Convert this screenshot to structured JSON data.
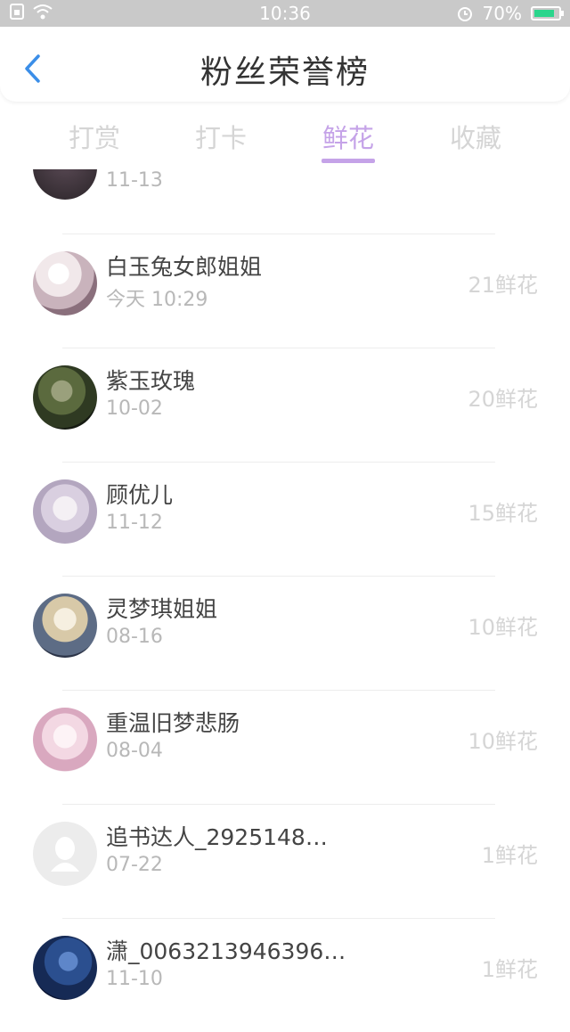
{
  "status_bar": {
    "time": "10:36",
    "battery_percent": "70%",
    "icons": [
      "sim-icon",
      "wifi-icon",
      "alarm-icon",
      "battery-icon"
    ]
  },
  "header": {
    "title": "粉丝荣誉榜",
    "back_icon": "chevron-left-icon"
  },
  "tabs": [
    {
      "label": "打赏",
      "active": false
    },
    {
      "label": "打卡",
      "active": false
    },
    {
      "label": "鲜花",
      "active": true
    },
    {
      "label": "收藏",
      "active": false
    }
  ],
  "colors": {
    "accent": "#c5a3e8",
    "back_icon": "#3b8ee8",
    "status_bar": "#c9c9c9",
    "battery": "#2ad58c"
  },
  "list": {
    "partial_row": {
      "date": "11-13"
    },
    "items": [
      {
        "name": "白玉兔女郎姐姐",
        "date": "今天 10:29",
        "score": "21鲜花"
      },
      {
        "name": "紫玉玫瑰",
        "date": "10-02",
        "score": "20鲜花"
      },
      {
        "name": "顾优儿",
        "date": "11-12",
        "score": "15鲜花"
      },
      {
        "name": "灵梦琪姐姐",
        "date": "08-16",
        "score": "10鲜花"
      },
      {
        "name": "重温旧梦悲肠",
        "date": "08-04",
        "score": "10鲜花"
      },
      {
        "name": "追书达人_2925148…",
        "date": "07-22",
        "score": "1鲜花"
      },
      {
        "name": "潇_0063213946396…",
        "date": "11-10",
        "score": "1鲜花"
      }
    ]
  }
}
